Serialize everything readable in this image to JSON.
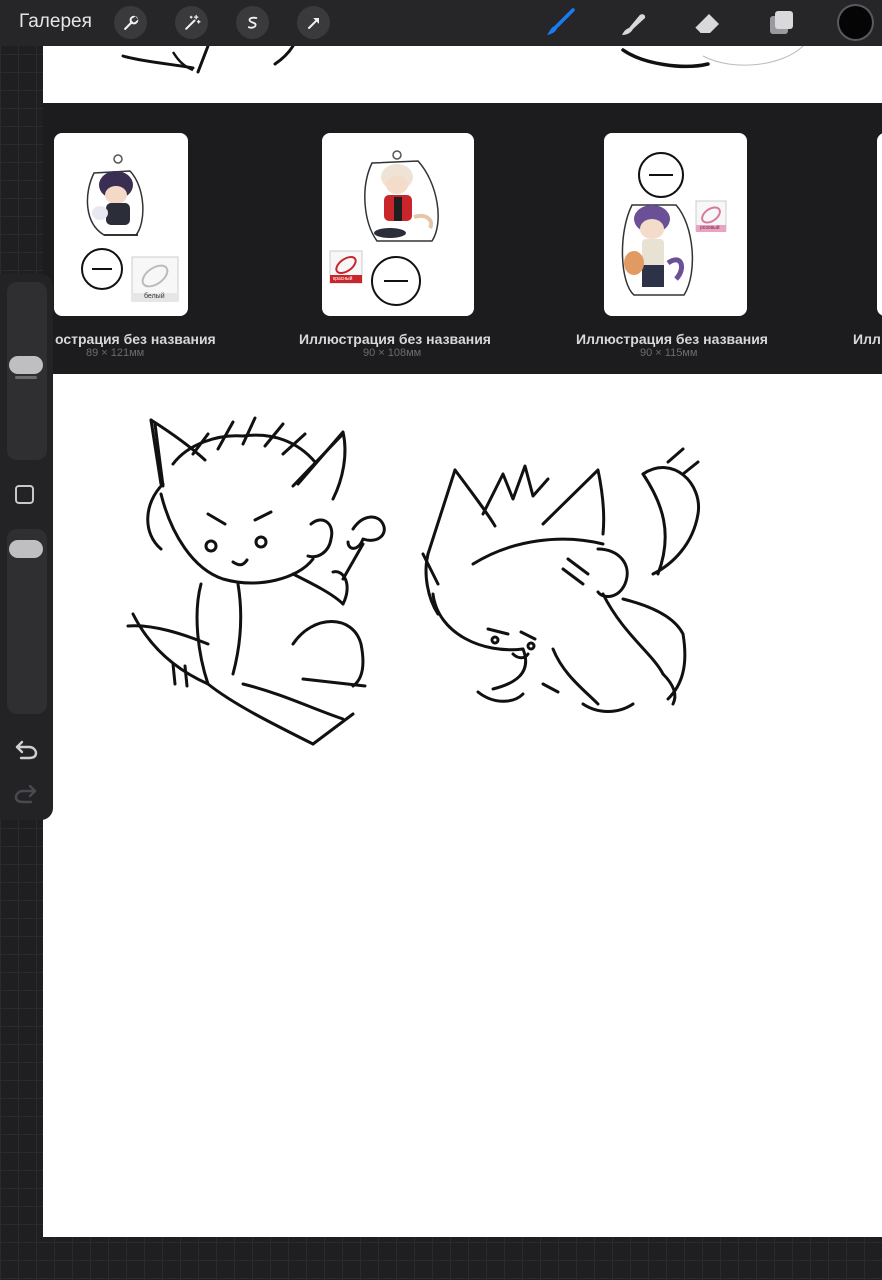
{
  "toolbar": {
    "gallery_label": "Галерея",
    "left_tools": [
      "wrench-icon",
      "magic-wand-icon",
      "selection-icon",
      "transform-arrow-icon"
    ],
    "right_tools": [
      "brush-icon",
      "smudge-icon",
      "eraser-icon",
      "layers-icon"
    ],
    "active_tool": "brush-icon",
    "accent_color": "#1a7cf2",
    "current_color": "#050505"
  },
  "gallery_strip": {
    "items": [
      {
        "title": "острация без названия",
        "size": "89 × 121мм",
        "tag": "белый"
      },
      {
        "title": "Иллюстрация без названия",
        "size": "90 × 108мм",
        "tag": "красный"
      },
      {
        "title": "Иллюстрация без названия",
        "size": "90 × 115мм",
        "tag": "розовый"
      },
      {
        "title": "Илл",
        "size": ""
      }
    ]
  },
  "sidebar": {
    "tools": [
      "brush-size-slider",
      "modify-button",
      "opacity-slider",
      "undo-icon",
      "redo-icon"
    ]
  }
}
